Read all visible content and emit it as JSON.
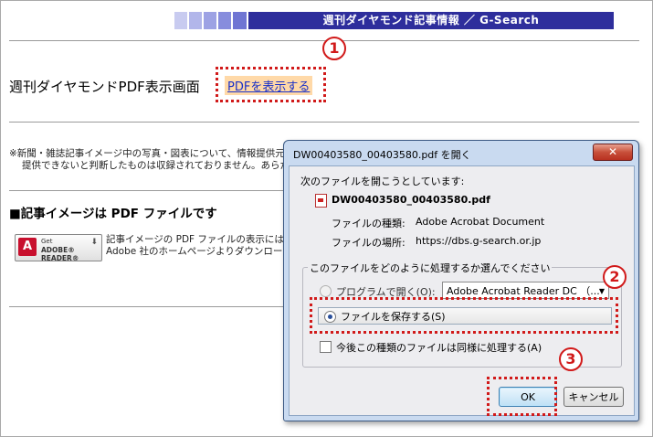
{
  "header": {
    "title": "週刊ダイヤモンド記事情報 ／ G-Search",
    "accent": "#2e2e9c"
  },
  "page": {
    "title": "週刊ダイヤモンドPDF表示画面",
    "pdf_link": "PDFを表示する",
    "note_line1": "※新聞・雑誌記事イメージ中の写真・図表について、情報提供元",
    "note_line2": "提供できないと判断したものは収録されておりません。あらかじ",
    "section_heading": "■記事イメージは PDF ファイルです",
    "adobe_get": "Get",
    "adobe_reader": "ADOBE® READER®",
    "adobe_text_line1": "記事イメージの PDF ファイルの表示には、",
    "adobe_text_line2": "Adobe 社のホームページよりダウンロード"
  },
  "markers": {
    "step1": "1",
    "step2": "2",
    "step3": "3",
    "color": "#d11a1a"
  },
  "dialog": {
    "title": "DW00403580_00403580.pdf を開く",
    "close": "✕",
    "opening_label": "次のファイルを開こうとしています:",
    "file_name": "DW00403580_00403580.pdf",
    "type_label": "ファイルの種類:",
    "type_value": "Adobe Acrobat Document",
    "location_label": "ファイルの場所:",
    "location_value": "https://dbs.g-search.or.jp",
    "question": "このファイルをどのように処理するか選んでください",
    "open_with_label": "プログラムで開く(O):",
    "open_with_value": "Adobe Acrobat Reader DC （...",
    "save_label": "ファイルを保存する(S)",
    "remember_label": "今後この種類のファイルは同様に処理する(A)",
    "ok": "OK",
    "cancel": "キャンセル"
  }
}
